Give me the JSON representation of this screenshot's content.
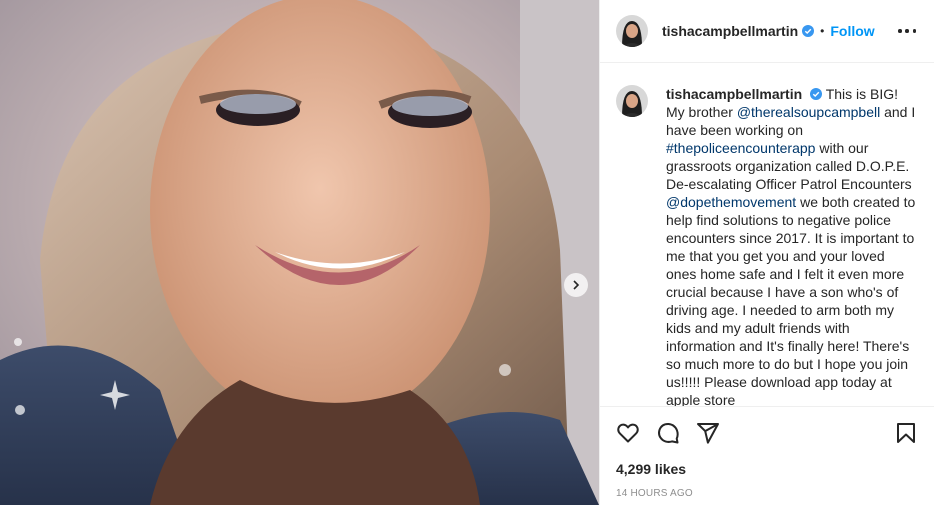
{
  "media": {
    "description_icon": "photo-of-smiling-woman",
    "next_icon": "chevron-right-icon"
  },
  "header": {
    "username": "tishacampbellmartin",
    "verified_icon": "verified-badge-icon",
    "separator": "•",
    "follow_label": "Follow",
    "more_icon": "more-options-icon"
  },
  "caption": {
    "username": "tishacampbellmartin",
    "parts": [
      {
        "text": "This is BIG! My brother ",
        "link": false
      },
      {
        "text": "@therealsoupcampbell",
        "link": true
      },
      {
        "text": " and I have been working on ",
        "link": false
      },
      {
        "text": "#thepoliceencounterapp",
        "link": true
      },
      {
        "text": " with our grassroots organization called D.O.P.E. De-escalating Officer Patrol Encounters ",
        "link": false
      },
      {
        "text": "@dopethemovement",
        "link": true
      },
      {
        "text": " we both created to help find solutions to negative police encounters since 2017. It is important to me that you get you and your loved ones home safe and I felt it even more crucial because I have a son who's of driving age. I needed to arm both my kids and my adult friends with information and It's finally here! There's so much more to do but I hope you join us!!!!! Please download app today at apple store",
        "link": false
      }
    ]
  },
  "actions": {
    "like_icon": "heart-icon",
    "comment_icon": "comment-icon",
    "share_icon": "share-icon",
    "save_icon": "bookmark-icon"
  },
  "likes_text": "4,299 likes",
  "timestamp": "14 HOURS AGO",
  "colors": {
    "accent": "#0095f6",
    "link": "#00376b",
    "verified": "#3897f0",
    "muted": "#8e8e8e"
  }
}
